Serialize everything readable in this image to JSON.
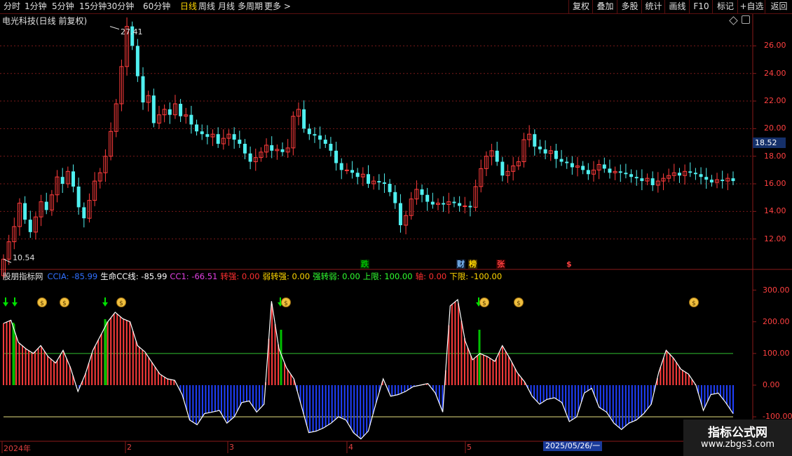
{
  "toolbar": {
    "periods": [
      "分时",
      "1分钟",
      "5分钟",
      "15分钟",
      "30分钟",
      "60分钟",
      "日线",
      "周线",
      "月线",
      "多周期",
      "更多 >"
    ],
    "active_period": "日线",
    "right_buttons": [
      "复权",
      "叠加",
      "多股",
      "统计",
      "画线",
      "F10",
      "标记",
      "+自选",
      "返回"
    ]
  },
  "stock_title": "电光科技(日线 前复权)",
  "price_axis": [
    "26.00",
    "24.00",
    "22.00",
    "20.00",
    "18.00",
    "16.00",
    "14.00",
    "12.00"
  ],
  "current_price": "18.52",
  "high_label": "27.41",
  "low_label": "10.54",
  "event_markers": [
    {
      "label": "跌",
      "color": "#00c000",
      "bg": "#003000"
    },
    {
      "label": "财",
      "color": "#80c0ff",
      "bg": "#10203a"
    },
    {
      "label": "榜",
      "color": "#ffd700",
      "bg": "#3a2a00"
    },
    {
      "label": "张",
      "color": "#ff4040",
      "bg": "#3a0000"
    },
    {
      "label": "$",
      "color": "#ff4040",
      "bg": "#000"
    }
  ],
  "indicator": {
    "name": "股朋指标网",
    "items": [
      {
        "label": "CCIA: -85.99",
        "color": "#3070ff"
      },
      {
        "label": "生命CC线: -85.99",
        "color": "#ffffff"
      },
      {
        "label": "CC1: -66.51",
        "color": "#e040e0"
      },
      {
        "label": "转强: 0.00",
        "color": "#ff3030"
      },
      {
        "label": "弱转强: 0.00",
        "color": "#ffd700"
      },
      {
        "label": "强转弱: 0.00",
        "color": "#30ff30"
      },
      {
        "label": "上限: 100.00",
        "color": "#30ff30"
      },
      {
        "label": "轴: 0.00",
        "color": "#ff3030"
      },
      {
        "label": "下限: -100.00",
        "color": "#ffd700"
      }
    ]
  },
  "indicator_axis": [
    "300.00",
    "200.00",
    "100.00",
    "0.00",
    "-100.00"
  ],
  "x_axis": [
    "2024年",
    "2",
    "3",
    "4",
    "5"
  ],
  "cursor_date": "2025/05/26/一",
  "watermark": {
    "line1": "指标公式网",
    "line2": "www.zbgs3.com"
  },
  "colors": {
    "up": "#ff3c3c",
    "down": "#50f0f0",
    "pos_bar": "#ff3c3c",
    "neg_bar": "#2040ff",
    "green_bar": "#00c000"
  },
  "chart_data": {
    "type": "candlestick",
    "y_range": [
      10.0,
      27.9
    ],
    "closes": [
      10.54,
      11.8,
      12.9,
      14.6,
      13.4,
      12.5,
      13.6,
      14.7,
      14.1,
      15.2,
      16.5,
      16.0,
      16.9,
      15.8,
      14.3,
      13.5,
      14.8,
      16.2,
      16.8,
      18.0,
      19.8,
      21.8,
      24.5,
      27.41,
      26.0,
      23.8,
      21.9,
      22.4,
      20.4,
      21.0,
      21.4,
      21.0,
      21.8,
      20.9,
      21.0,
      20.3,
      19.8,
      19.6,
      19.4,
      19.6,
      18.9,
      19.3,
      19.6,
      19.2,
      18.9,
      18.2,
      17.6,
      17.9,
      18.3,
      18.8,
      18.4,
      18.5,
      18.3,
      18.6,
      20.9,
      21.4,
      20.0,
      19.6,
      19.5,
      19.2,
      18.9,
      18.4,
      17.5,
      17.0,
      17.0,
      16.8,
      16.5,
      16.7,
      16.0,
      16.2,
      16.1,
      16.0,
      15.4,
      14.6,
      13.0,
      13.7,
      14.9,
      15.6,
      15.2,
      14.7,
      14.5,
      14.6,
      14.5,
      14.7,
      14.6,
      14.4,
      14.4,
      14.3,
      15.8,
      17.1,
      18.0,
      18.4,
      17.6,
      16.6,
      16.9,
      17.3,
      17.6,
      19.2,
      19.6,
      18.7,
      18.5,
      18.2,
      18.4,
      17.8,
      17.6,
      17.5,
      17.2,
      17.3,
      17.0,
      16.7,
      17.0,
      17.4,
      17.1,
      16.8,
      16.9,
      16.8,
      16.7,
      16.5,
      16.4,
      16.2,
      16.4,
      15.9,
      16.2,
      16.4,
      16.6,
      16.8,
      16.6,
      16.9,
      16.8,
      16.7,
      16.5,
      16.3,
      16.1,
      16.3,
      16.2,
      16.4,
      16.2
    ],
    "indicator_values": [
      195,
      205,
      135,
      115,
      100,
      125,
      90,
      70,
      110,
      55,
      -20,
      35,
      110,
      155,
      200,
      230,
      210,
      200,
      125,
      105,
      70,
      35,
      20,
      15,
      -30,
      -110,
      -125,
      -90,
      -85,
      -80,
      -120,
      -100,
      -55,
      -50,
      -85,
      -60,
      265,
      115,
      55,
      20,
      -65,
      -150,
      -145,
      -135,
      -120,
      -100,
      -110,
      -150,
      -170,
      -145,
      -60,
      20,
      -35,
      -30,
      -20,
      -5,
      0,
      5,
      -25,
      -85,
      250,
      270,
      140,
      80,
      100,
      90,
      75,
      125,
      85,
      40,
      10,
      -35,
      -60,
      -45,
      -40,
      -55,
      -115,
      -100,
      -25,
      -10,
      -70,
      -85,
      -120,
      -140,
      -120,
      -110,
      -90,
      -60,
      40,
      110,
      85,
      50,
      35,
      0,
      -80,
      -30,
      -25,
      -55,
      -90
    ],
    "upper_limit": 100,
    "axis_line": 0,
    "lower_limit": -100,
    "indicator_range": [
      -175,
      330
    ]
  }
}
